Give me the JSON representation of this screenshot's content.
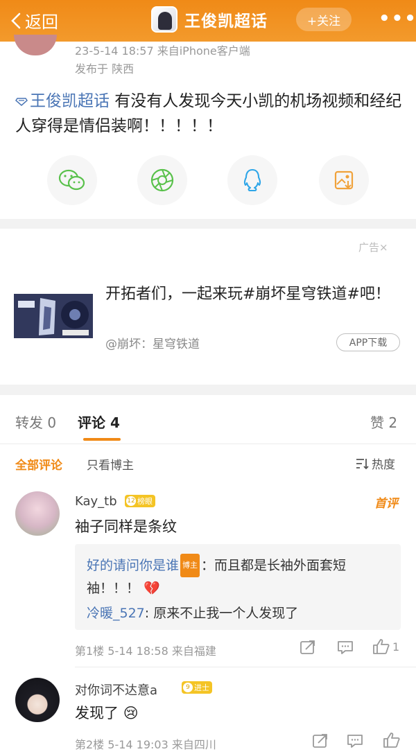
{
  "header": {
    "back_label": "返回",
    "title": "王俊凯超话",
    "follow_label": "+关注",
    "more_label": "•••"
  },
  "post": {
    "meta": "23-5-14 18:57  来自iPhone客户端",
    "location": "发布于 陕西",
    "topic": "王俊凯超话",
    "text": " 有没有人发现今天小凯的机场视频和经纪人穿得是情侣装啊！！！！！"
  },
  "share_targets": [
    "wechat-icon",
    "moments-icon",
    "qq-icon",
    "save-image-icon"
  ],
  "ad": {
    "label": "广告×",
    "text": "开拓者们，一起来玩#崩坏星穹铁道#吧！",
    "sub": "@崩坏：星穹铁道",
    "button": "APP下载"
  },
  "tabs": {
    "repost": "转发 0",
    "comment": "评论 4",
    "like": "赞 2"
  },
  "filters": {
    "all": "全部评论",
    "author": "只看博主",
    "sort": "热度"
  },
  "comments": [
    {
      "name": "Kay_tb",
      "badge_level": "12",
      "badge_text": "榜眼",
      "first_label": "首评",
      "text": "袖子同样是条纹",
      "replies": [
        {
          "name": "好的请问你是谁",
          "tag": "博主",
          "text": "：而且都是长袖外面套短袖！！！",
          "emoji": "💔"
        },
        {
          "name": "冷暖_527",
          "text": ": 原来不止我一个人发现了"
        }
      ],
      "meta": "第1楼 5-14 18:58 来自福建",
      "likes": "1"
    },
    {
      "name": "对你词不达意a",
      "badge_level": "9",
      "badge_text": "进士",
      "text": "发现了",
      "emoji": "😢",
      "meta": "第2楼 5-14 19:03 来自四川",
      "likes": ""
    }
  ],
  "colors": {
    "accent": "#f08a17",
    "link": "#4a75b5",
    "badge": "#f4c425"
  }
}
